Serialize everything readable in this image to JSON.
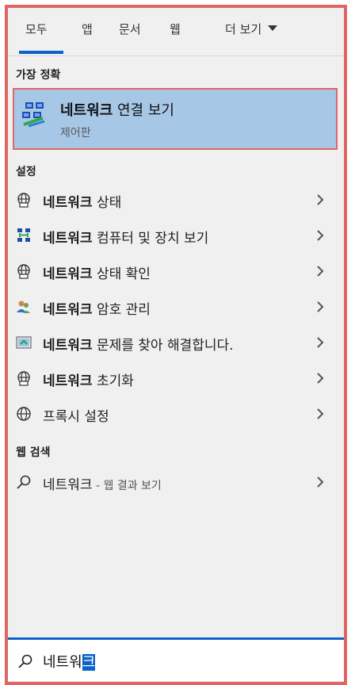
{
  "tabs": {
    "all": "모두",
    "apps": "앱",
    "documents": "문서",
    "web": "웹",
    "more": "더 보기"
  },
  "best_match": {
    "section_label": "가장 정확",
    "title_bold": "네트워크",
    "title_rest": " 연결 보기",
    "subtitle": "제어판"
  },
  "settings": {
    "section_label": "설정",
    "items": [
      {
        "bold": "네트워크",
        "rest": " 상태",
        "icon": "globe-network-icon"
      },
      {
        "bold": "네트워크",
        "rest": " 컴퓨터 및 장치 보기",
        "icon": "network-computers-icon"
      },
      {
        "bold": "네트워크",
        "rest": " 상태 확인",
        "icon": "globe-network-icon"
      },
      {
        "bold": "네트워크",
        "rest": " 암호 관리",
        "icon": "users-key-icon"
      },
      {
        "bold": "네트워크",
        "rest": " 문제를 찾아 해결합니다.",
        "icon": "troubleshoot-icon"
      },
      {
        "bold": "네트워크",
        "rest": " 초기화",
        "icon": "globe-network-icon"
      },
      {
        "bold": "",
        "rest": "프록시 설정",
        "icon": "globe-icon"
      }
    ]
  },
  "web_search": {
    "section_label": "웹 검색",
    "query": "네트워크",
    "suffix": " - 웹 결과 보기"
  },
  "search": {
    "typed": "네트워",
    "selected": "크"
  },
  "colors": {
    "accent": "#0a63c9",
    "highlight_bg": "#a7c7e7",
    "annotation_border": "#e06666",
    "panel_bg": "#f0f0f0"
  }
}
